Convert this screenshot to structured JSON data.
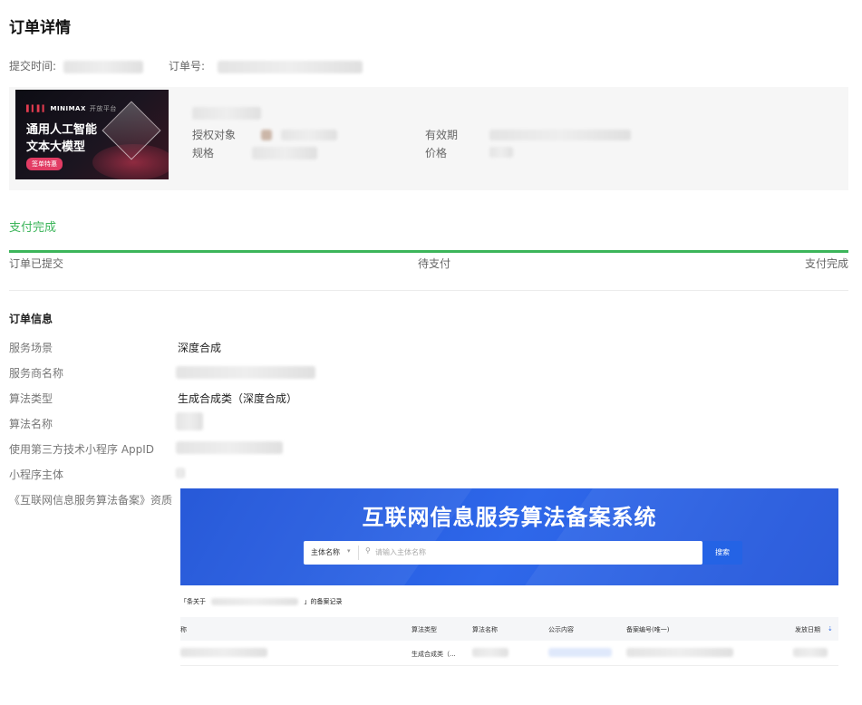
{
  "page": {
    "title": "订单详情"
  },
  "meta": {
    "submit_time_label": "提交时间:",
    "order_no_label": "订单号:"
  },
  "product": {
    "banner": {
      "brand": "MINIMAX",
      "brand_sub": "开放平台",
      "line1": "通用人工智能",
      "line2": "文本大模型",
      "cta": "签单特惠"
    },
    "auth_target_label": "授权对象",
    "validity_label": "有效期",
    "spec_label": "规格",
    "price_label": "价格"
  },
  "status": {
    "title": "支付完成",
    "progress": 1.0,
    "steps": [
      "订单已提交",
      "待支付",
      "支付完成"
    ]
  },
  "order_info": {
    "heading": "订单信息",
    "rows": [
      {
        "label": "服务场景",
        "value": "深度合成"
      },
      {
        "label": "服务商名称",
        "value": ""
      },
      {
        "label": "算法类型",
        "value": "生成合成类（深度合成）"
      },
      {
        "label": "算法名称",
        "value": ""
      },
      {
        "label": "使用第三方技术小程序 AppID",
        "value": ""
      },
      {
        "label": "小程序主体",
        "value": ""
      },
      {
        "label": "《互联网信息服务算法备案》资质",
        "value": ""
      }
    ]
  },
  "certificate": {
    "title": "互联网信息服务算法备案系统",
    "search_select": "主体名称",
    "search_placeholder": "请输入主体名称",
    "search_button": "搜索",
    "result_prefix": "「条关于",
    "result_suffix": "」的备案记录",
    "columns": [
      "称",
      "算法类型",
      "算法名称",
      "公示内容",
      "备案编号(唯一)",
      "发放日期"
    ],
    "row": {
      "algorithm_type": "生成合成类（..."
    }
  },
  "colors": {
    "success": "#3cb55a",
    "hero_blue": "#1f56dc"
  }
}
